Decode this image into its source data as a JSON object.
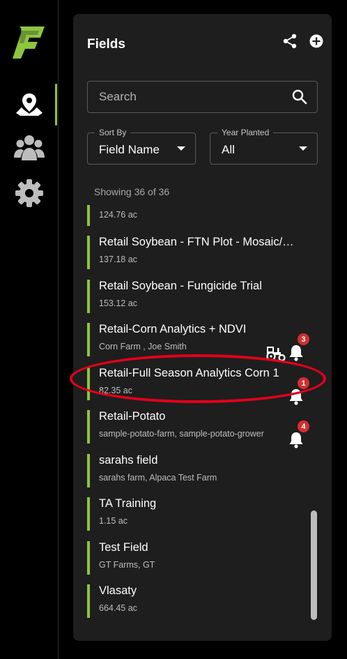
{
  "colors": {
    "accent": "#8dc63f",
    "badge": "#d32f2f",
    "annotation": "#e3001b",
    "panel": "#1e1e1e"
  },
  "rail": {
    "logo_icon": "app-logo-icon",
    "items": [
      {
        "icon": "map-pin-icon",
        "active": true
      },
      {
        "icon": "people-group-icon",
        "active": false
      },
      {
        "icon": "gear-icon",
        "active": false
      }
    ]
  },
  "panel": {
    "title": "Fields",
    "share_icon": "share-icon",
    "add_icon": "add-circle-icon",
    "search": {
      "placeholder": "Search",
      "value": "",
      "icon": "search-icon"
    },
    "sort_by": {
      "label": "Sort By",
      "value": "Field Name"
    },
    "year_planted": {
      "label": "Year Planted",
      "value": "All"
    },
    "showing": "Showing 36 of 36"
  },
  "fields": [
    {
      "name": "",
      "sub": "124.76 ac"
    },
    {
      "name": "Retail Soybean - FTN Plot - Mosaic/Q...",
      "sub": "137.18 ac"
    },
    {
      "name": "Retail Soybean - Fungicide Trial",
      "sub": "153.12 ac"
    },
    {
      "name": "Retail-Corn Analytics + NDVI",
      "sub": "Corn Farm , Joe Smith",
      "tractor_icon": "tractor-icon",
      "alerts": "3"
    },
    {
      "name": "Retail-Full Season Analytics Corn 1",
      "sub": "82.35 ac",
      "alerts": "1"
    },
    {
      "name": "Retail-Potato",
      "sub": "sample-potato-farm, sample-potato-grower",
      "alerts": "4"
    },
    {
      "name": "sarahs field",
      "sub": "sarahs farm, Alpaca Test Farm"
    },
    {
      "name": "TA Training",
      "sub": "1.15 ac"
    },
    {
      "name": "Test Field",
      "sub": "GT Farms, GT"
    },
    {
      "name": "Vlasaty",
      "sub": "664.45 ac"
    }
  ]
}
